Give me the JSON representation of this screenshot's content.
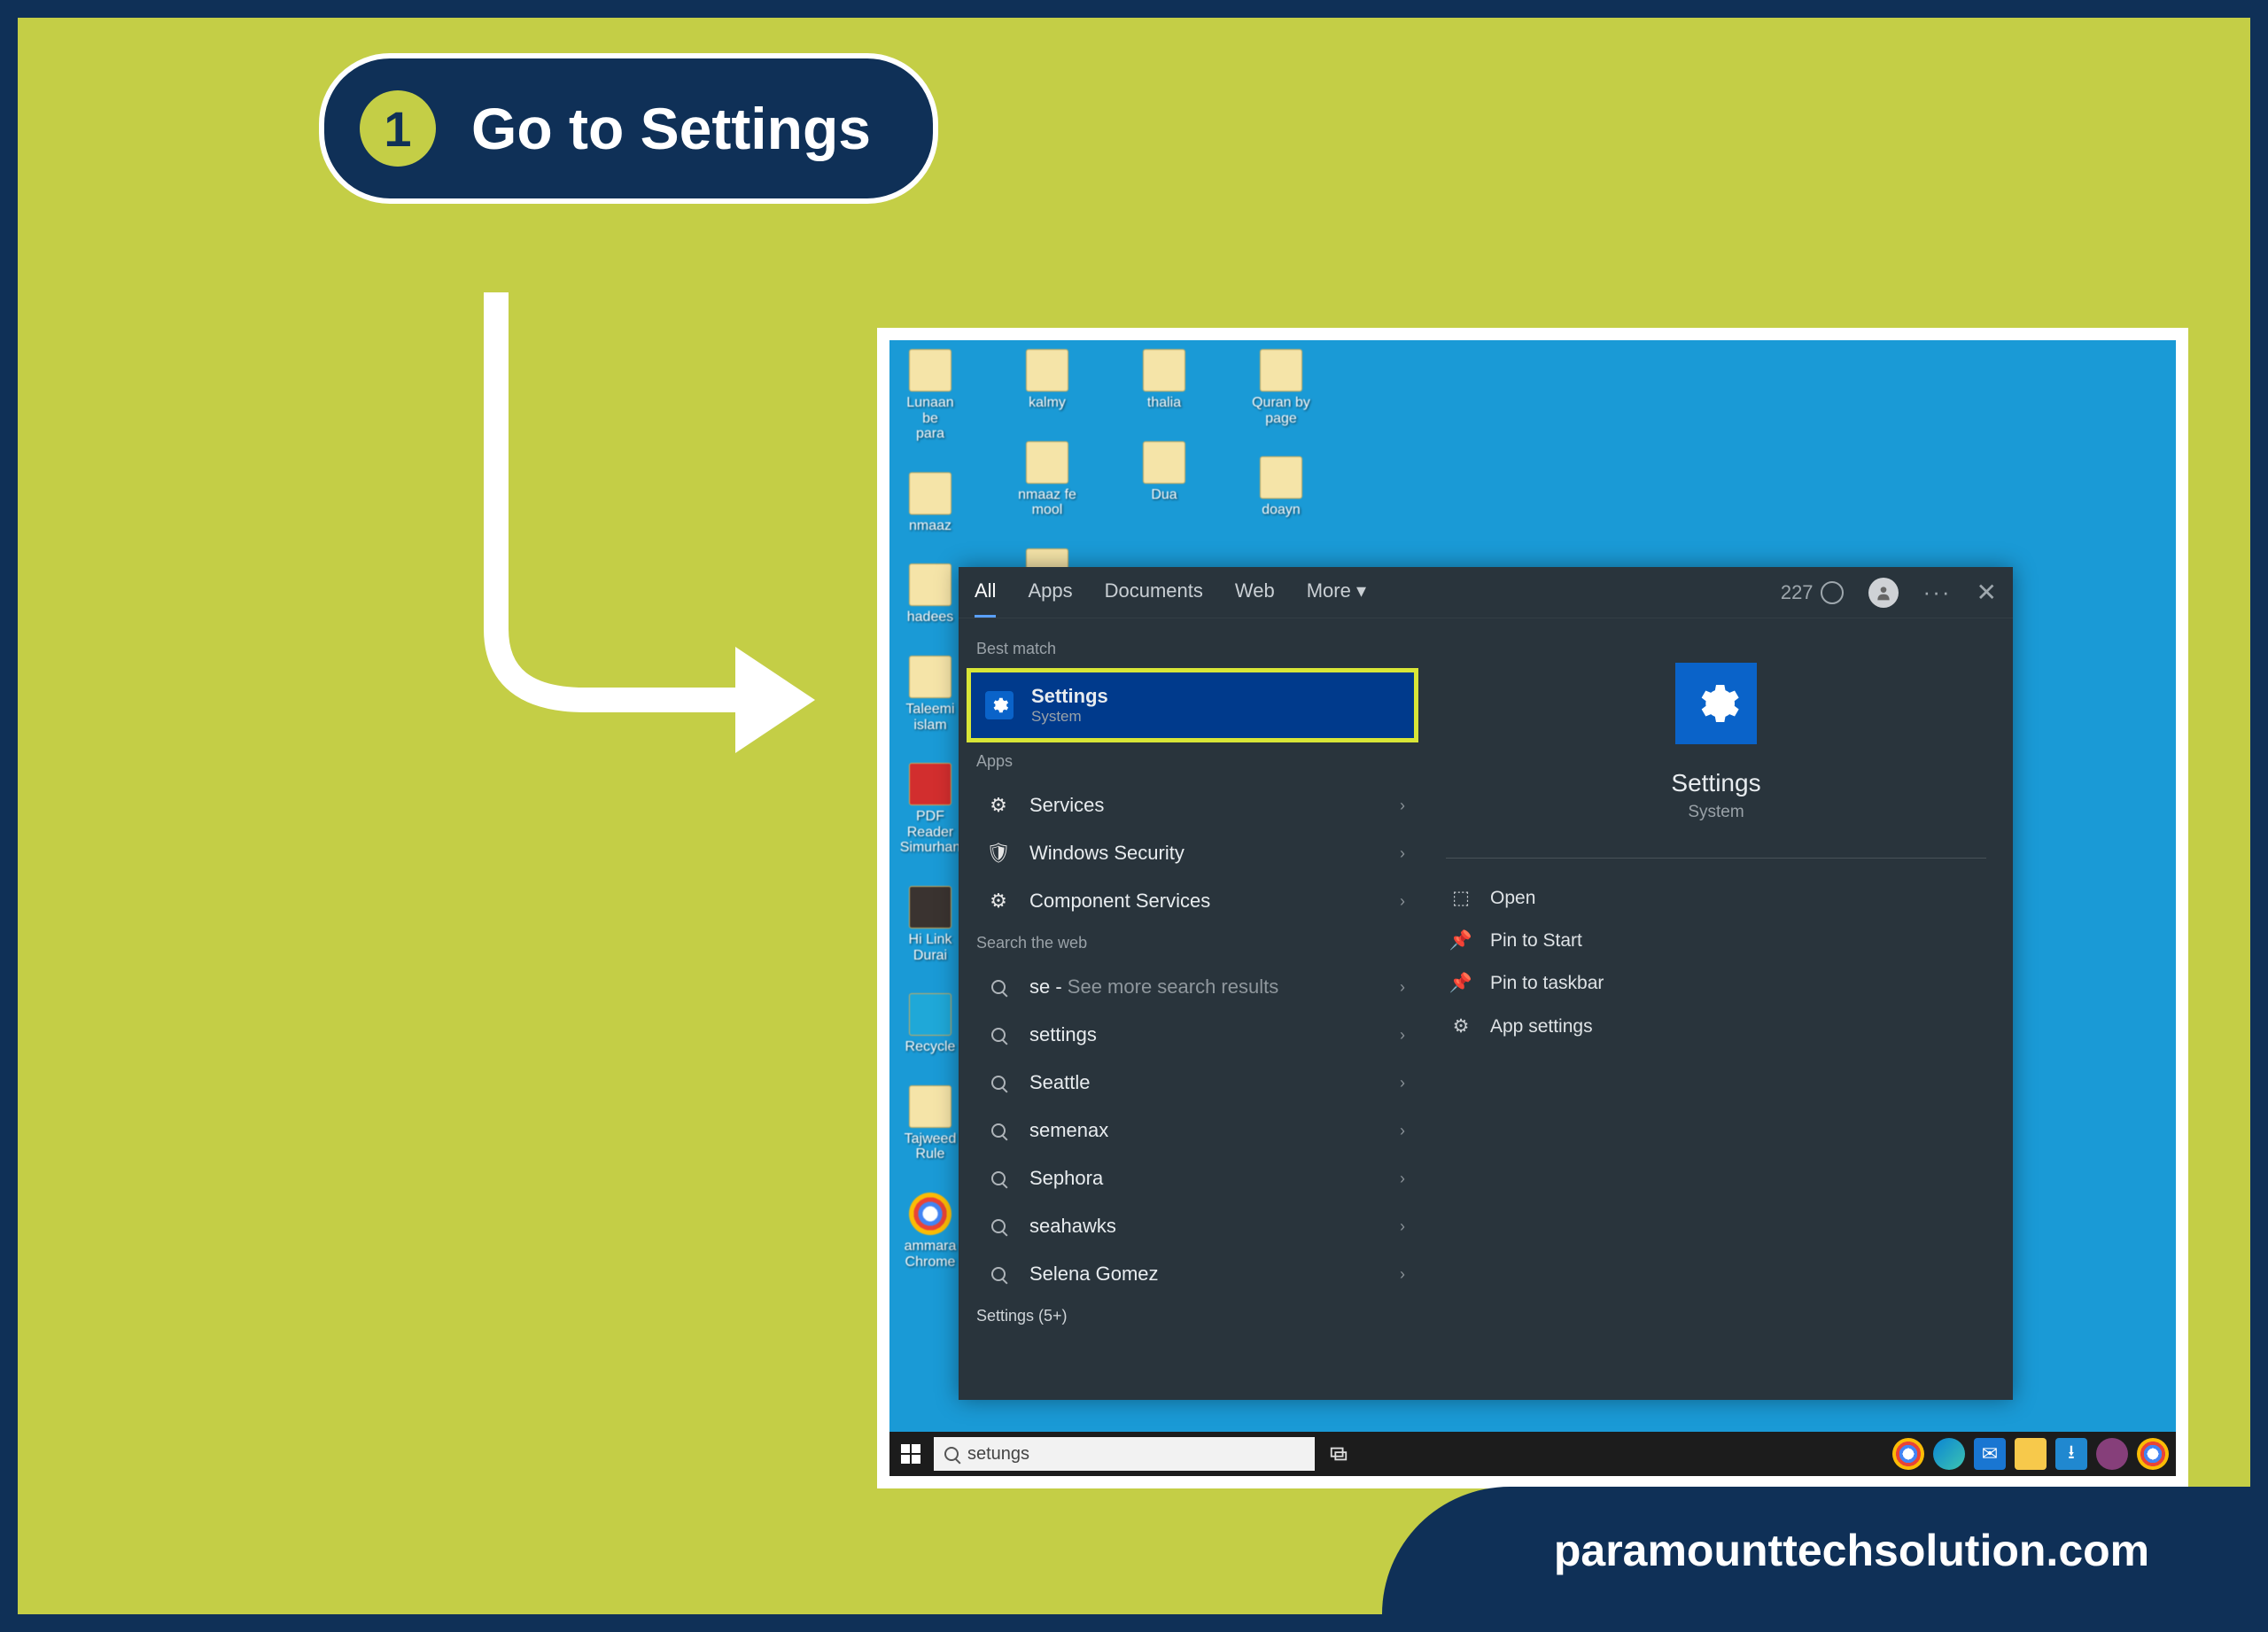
{
  "step": {
    "number": "1",
    "title": "Go to Settings"
  },
  "footer": "paramounttechsolution.com",
  "desktop": {
    "cols": [
      [
        {
          "label": "Lunaan be\npara",
          "cls": "glyph"
        },
        {
          "label": "nmaaz",
          "cls": "glyph"
        },
        {
          "label": "hadees",
          "cls": "glyph"
        },
        {
          "label": "Taleemi\nislam",
          "cls": "glyph"
        },
        {
          "label": "PDF Reader\nSimurhan",
          "cls": "glyph pdf"
        },
        {
          "label": "Hi Link\nDurai",
          "cls": "glyph dark"
        },
        {
          "label": "Recycle",
          "cls": "glyph cyan"
        },
        {
          "label": "Tajweed\nRule",
          "cls": "glyph"
        },
        {
          "label": "ammara\nChrome",
          "cls": "glyph chrome"
        }
      ],
      [
        {
          "label": "kalmy",
          "cls": "glyph"
        },
        {
          "label": "nmaaz fe\nmool",
          "cls": "glyph"
        },
        {
          "label": "",
          "cls": "glyph"
        }
      ],
      [
        {
          "label": "thalia",
          "cls": "glyph"
        },
        {
          "label": "Dua",
          "cls": "glyph"
        }
      ],
      [
        {
          "label": "Quran by\npage",
          "cls": "glyph"
        },
        {
          "label": "doayn",
          "cls": "glyph"
        }
      ]
    ]
  },
  "search": {
    "tabs": [
      "All",
      "Apps",
      "Documents",
      "Web",
      "More"
    ],
    "activeTab": "All",
    "points": "227",
    "bestMatchLabel": "Best match",
    "bestMatch": {
      "title": "Settings",
      "subtitle": "System"
    },
    "appsLabel": "Apps",
    "apps": [
      {
        "icon": "⚙",
        "label": "Services"
      },
      {
        "icon": "🛡",
        "label": "Windows Security"
      },
      {
        "icon": "⚙",
        "label": "Component Services"
      }
    ],
    "webLabel": "Search the web",
    "web": [
      {
        "label": "se",
        "suffix": "See more search results"
      },
      {
        "label": "settings",
        "suffix": ""
      },
      {
        "label": "Seattle",
        "suffix": ""
      },
      {
        "label": "semenax",
        "suffix": ""
      },
      {
        "label": "Sephora",
        "suffix": ""
      },
      {
        "label": "seahawks",
        "suffix": ""
      },
      {
        "label": "Selena Gomez",
        "suffix": ""
      }
    ],
    "moreLabel": "Settings (5+)",
    "preview": {
      "title": "Settings",
      "subtitle": "System"
    },
    "actions": [
      {
        "icon": "⬚",
        "label": "Open"
      },
      {
        "icon": "📌",
        "label": "Pin to Start"
      },
      {
        "icon": "📌",
        "label": "Pin to taskbar"
      },
      {
        "icon": "⚙",
        "label": "App settings"
      }
    ],
    "input": "setungs"
  }
}
